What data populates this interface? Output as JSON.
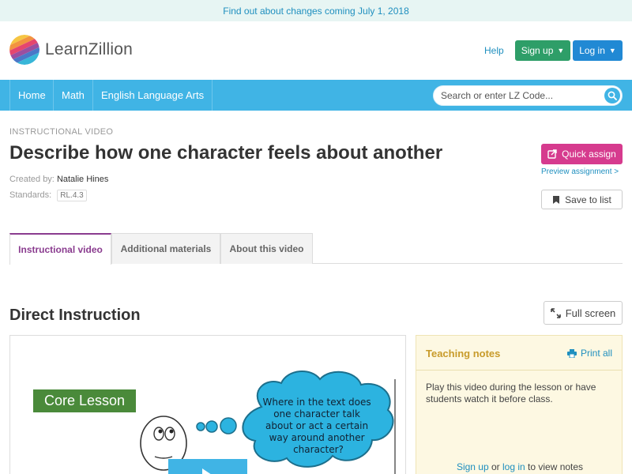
{
  "announcement": {
    "text": "Find out about changes coming July 1, 2018"
  },
  "header": {
    "logo_text": "LearnZillion",
    "help_label": "Help",
    "signup_label": "Sign up",
    "login_label": "Log in"
  },
  "nav": {
    "items": [
      {
        "label": "Home"
      },
      {
        "label": "Math"
      },
      {
        "label": "English Language Arts"
      }
    ],
    "search_placeholder": "Search or enter LZ Code..."
  },
  "lesson": {
    "content_type": "INSTRUCTIONAL VIDEO",
    "title": "Describe how one character feels about another",
    "created_by_label": "Created by:",
    "author": "Natalie Hines",
    "standards_label": "Standards:",
    "standard": "RL.4.3"
  },
  "actions": {
    "quick_assign_label": "Quick assign",
    "preview_label": "Preview assignment >",
    "save_label": "Save to list"
  },
  "tabs": [
    {
      "label": "Instructional video",
      "active": true
    },
    {
      "label": "Additional materials",
      "active": false
    },
    {
      "label": "About this video",
      "active": false
    }
  ],
  "section": {
    "title": "Direct Instruction",
    "fullscreen_label": "Full screen"
  },
  "video": {
    "core_label": "Core Lesson",
    "bubble_lines": [
      "Where in the text does",
      "one character talk",
      "about or act a certain",
      "way around another",
      "character?"
    ]
  },
  "notes": {
    "title": "Teaching notes",
    "print_label": "Print all",
    "body": "Play this video during the lesson or have students watch it before class.",
    "signup_link": "Sign up",
    "or_text": " or ",
    "login_link": "log in",
    "suffix": " to view notes"
  },
  "colors": {
    "brand_blue": "#40b4e5",
    "signup_green": "#2e9e68",
    "login_blue": "#2189d4",
    "assign_pink": "#d63b8e",
    "tab_purple": "#8a3c8f",
    "notes_gold": "#c89b2b"
  }
}
